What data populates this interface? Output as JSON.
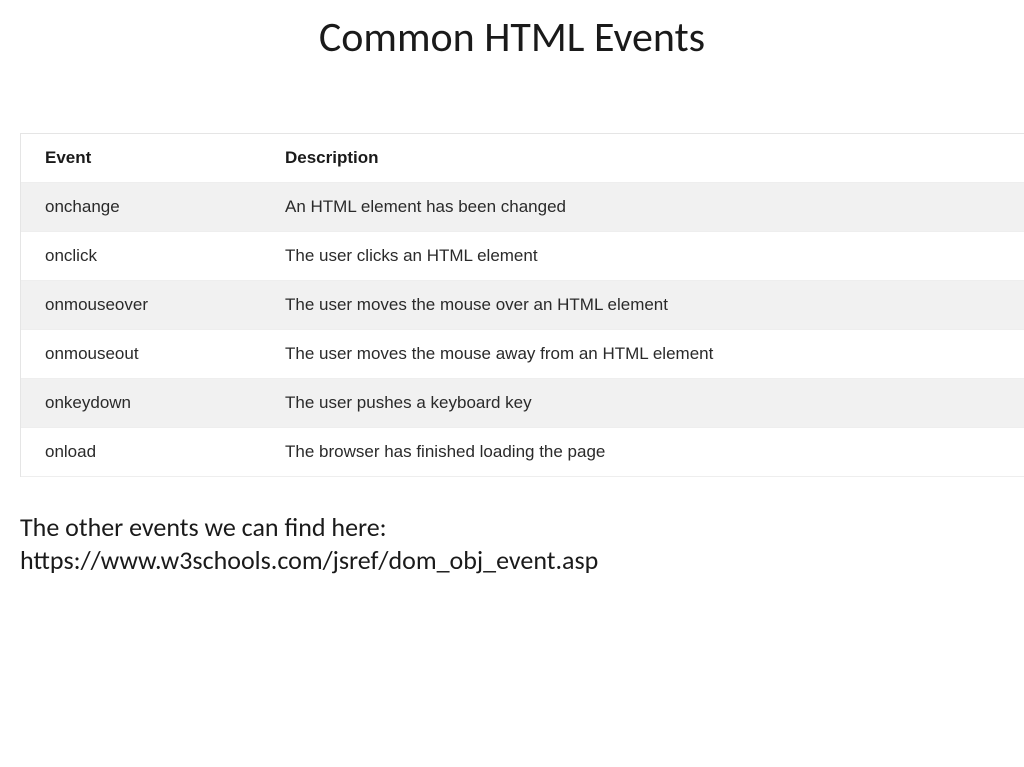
{
  "title": "Common HTML Events",
  "table": {
    "headers": {
      "event": "Event",
      "description": "Description"
    },
    "rows": [
      {
        "event": "onchange",
        "description": "An HTML element has been changed"
      },
      {
        "event": "onclick",
        "description": "The user clicks an HTML element"
      },
      {
        "event": "onmouseover",
        "description": "The user moves the mouse over an HTML element"
      },
      {
        "event": "onmouseout",
        "description": "The user moves the mouse away from an HTML element"
      },
      {
        "event": "onkeydown",
        "description": "The user pushes a keyboard key"
      },
      {
        "event": "onload",
        "description": "The browser has finished loading the page"
      }
    ]
  },
  "footer": {
    "line1": "The other events we can find here:",
    "line2": "https://www.w3schools.com/jsref/dom_obj_event.asp"
  }
}
